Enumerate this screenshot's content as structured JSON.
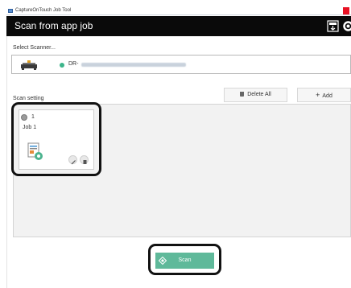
{
  "window": {
    "title": "CaptureOnTouch Job Tool"
  },
  "header": {
    "title": "Scan from app job",
    "icons": [
      "scanner-settings-icon",
      "gear-icon"
    ]
  },
  "scanner": {
    "label": "Select Scanner...",
    "model_prefix": "DR-",
    "status_color": "#3db58b",
    "icon": "scanner-icon"
  },
  "toolbar": {
    "delete_all_label": "Delete All",
    "add_label": "Add",
    "delete_icon": "trash-icon",
    "add_icon": "plus-icon"
  },
  "scan_setting": {
    "label": "Scan setting",
    "jobs": [
      {
        "number": "1",
        "name": "Job 1",
        "icon": "document-scan-icon"
      }
    ]
  },
  "actions": {
    "scan_label": "Scan",
    "scan_color": "#5fb99a",
    "scan_icon": "scan-start-icon"
  },
  "colors": {
    "header_bg": "#0a0a0a",
    "accent_green": "#5fb99a",
    "panel_bg": "#f2f2f2"
  }
}
